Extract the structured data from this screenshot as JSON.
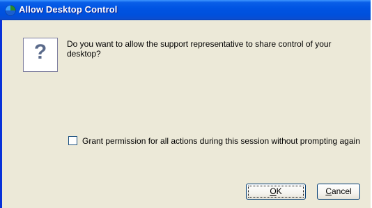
{
  "window": {
    "title": "Allow Desktop Control",
    "title_icon": "app-globe-icon"
  },
  "dialog": {
    "icon": "question-icon",
    "icon_glyph": "?",
    "message": "Do you want to allow the support representative to share control of your desktop?",
    "checkbox": {
      "label": "Grant permission for all actions during this session without prompting again",
      "checked": false
    }
  },
  "buttons": {
    "ok_label": "OK",
    "cancel_label": "Cancel"
  },
  "colors": {
    "titlebar": "#0054e3",
    "dialog_background": "#ece9d8",
    "border_accent": "#0831d9"
  }
}
